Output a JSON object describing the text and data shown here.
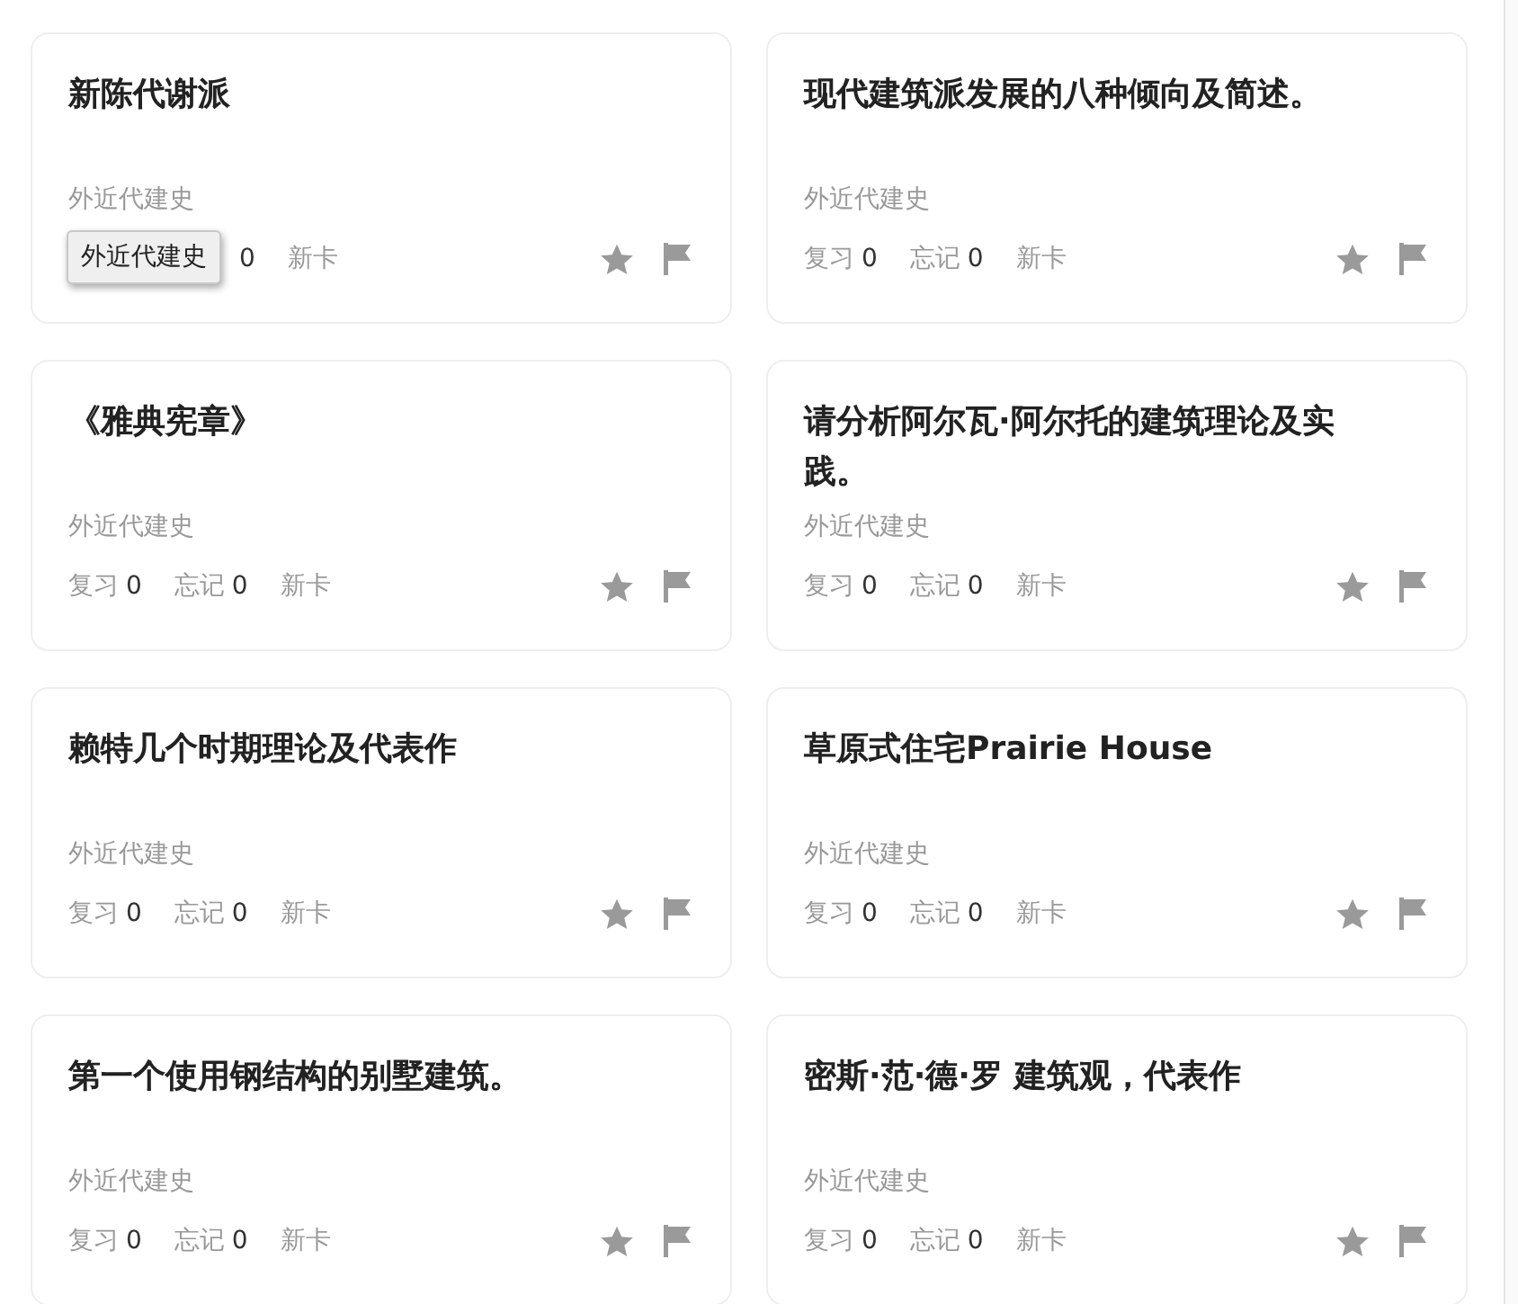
{
  "cards": [
    {
      "title": "新陈代谢派",
      "category": "外近代建史",
      "forget_count": "0",
      "new_label": "新卡"
    },
    {
      "title": "现代建筑派发展的八种倾向及简述。",
      "category": "外近代建史",
      "review_label": "复习",
      "review_count": "0",
      "forget_label": "忘记",
      "forget_count": "0",
      "new_label": "新卡"
    },
    {
      "title": "《雅典宪章》",
      "category": "外近代建史",
      "review_label": "复习",
      "review_count": "0",
      "forget_label": "忘记",
      "forget_count": "0",
      "new_label": "新卡"
    },
    {
      "title": "请分析阿尔瓦·阿尔托的建筑理论及实践。",
      "category": "外近代建史",
      "review_label": "复习",
      "review_count": "0",
      "forget_label": "忘记",
      "forget_count": "0",
      "new_label": "新卡"
    },
    {
      "title": "赖特几个时期理论及代表作",
      "category": "外近代建史",
      "review_label": "复习",
      "review_count": "0",
      "forget_label": "忘记",
      "forget_count": "0",
      "new_label": "新卡"
    },
    {
      "title": "草原式住宅Prairie House",
      "category": "外近代建史",
      "review_label": "复习",
      "review_count": "0",
      "forget_label": "忘记",
      "forget_count": "0",
      "new_label": "新卡"
    },
    {
      "title": "第一个使用钢结构的别墅建筑。",
      "category": "外近代建史",
      "review_label": "复习",
      "review_count": "0",
      "forget_label": "忘记",
      "forget_count": "0",
      "new_label": "新卡"
    },
    {
      "title": "密斯·范·德·罗  建筑观，代表作",
      "category": "外近代建史",
      "review_label": "复习",
      "review_count": "0",
      "forget_label": "忘记",
      "forget_count": "0",
      "new_label": "新卡"
    }
  ],
  "tooltip": {
    "text": "外近代建史"
  }
}
